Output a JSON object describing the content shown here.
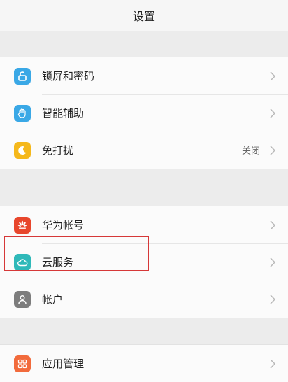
{
  "header": {
    "title": "设置"
  },
  "groups": [
    {
      "items": [
        {
          "label": "锁屏和密码",
          "icon": "lock-icon",
          "color": "#3aa8e6"
        },
        {
          "label": "智能辅助",
          "icon": "hand-icon",
          "color": "#3aa8e6"
        },
        {
          "label": "免打扰",
          "icon": "moon-icon",
          "color": "#f5b81b",
          "value": "关闭"
        }
      ]
    },
    {
      "items": [
        {
          "label": "华为帐号",
          "icon": "huawei-icon",
          "color": "#e8462c"
        },
        {
          "label": "云服务",
          "icon": "cloud-icon",
          "color": "#2fb9b9",
          "highlighted": true
        },
        {
          "label": "帐户",
          "icon": "person-icon",
          "color": "#7d7d7d"
        }
      ]
    },
    {
      "items": [
        {
          "label": "应用管理",
          "icon": "apps-grid-icon",
          "color": "#f26b3c"
        }
      ]
    }
  ],
  "colors": {
    "highlight_border": "#d63838",
    "chevron": "#b8b8b8"
  }
}
